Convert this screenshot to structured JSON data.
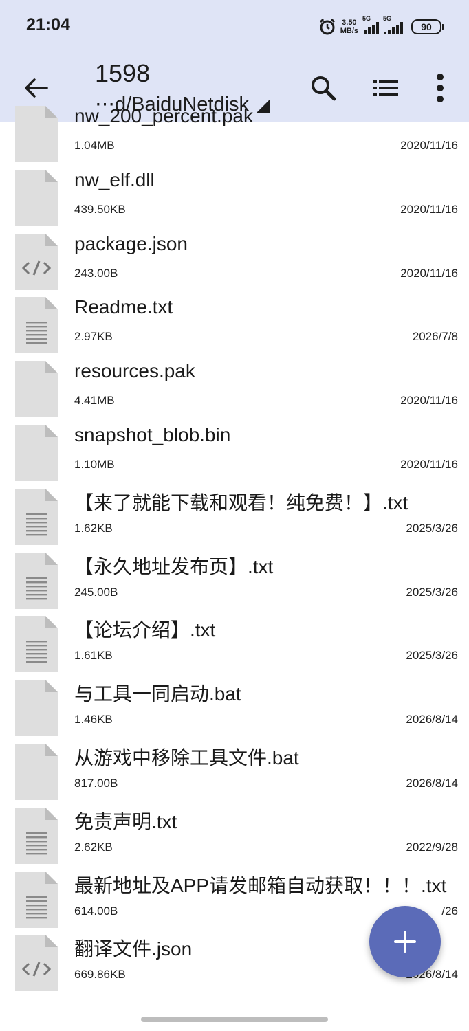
{
  "status": {
    "time": "21:04",
    "speed_value": "3.50",
    "speed_unit": "MB/s",
    "sim1_label": "5G",
    "sim2_label": "5G",
    "battery": "90",
    "icons": [
      "alarm-icon",
      "signal-icon",
      "battery-icon"
    ]
  },
  "appbar": {
    "title": "1598",
    "path": "⋯d/BaiduNetdisk",
    "icons": [
      "back-arrow-icon",
      "search-icon",
      "list-view-icon",
      "more-vert-icon"
    ]
  },
  "files": [
    {
      "name": "nw_200_percent.pak",
      "size": "1.04MB",
      "date": "2020/11/16",
      "icon": "file-generic"
    },
    {
      "name": "nw_elf.dll",
      "size": "439.50KB",
      "date": "2020/11/16",
      "icon": "file-generic"
    },
    {
      "name": "package.json",
      "size": "243.00B",
      "date": "2020/11/16",
      "icon": "file-code"
    },
    {
      "name": "Readme.txt",
      "size": "2.97KB",
      "date": "2026/7/8",
      "icon": "file-text"
    },
    {
      "name": "resources.pak",
      "size": "4.41MB",
      "date": "2020/11/16",
      "icon": "file-generic"
    },
    {
      "name": "snapshot_blob.bin",
      "size": "1.10MB",
      "date": "2020/11/16",
      "icon": "file-generic"
    },
    {
      "name": "【来了就能下载和观看！纯免费！】.txt",
      "size": "1.62KB",
      "date": "2025/3/26",
      "icon": "file-text"
    },
    {
      "name": "【永久地址发布页】.txt",
      "size": "245.00B",
      "date": "2025/3/26",
      "icon": "file-text"
    },
    {
      "name": "【论坛介绍】.txt",
      "size": "1.61KB",
      "date": "2025/3/26",
      "icon": "file-text"
    },
    {
      "name": "与工具一同启动.bat",
      "size": "1.46KB",
      "date": "2026/8/14",
      "icon": "file-generic"
    },
    {
      "name": "从游戏中移除工具文件.bat",
      "size": "817.00B",
      "date": "2026/8/14",
      "icon": "file-generic"
    },
    {
      "name": "免责声明.txt",
      "size": "2.62KB",
      "date": "2022/9/28",
      "icon": "file-text"
    },
    {
      "name": "最新地址及APP请发邮箱自动获取！！！.txt",
      "size": "614.00B",
      "date": "/26",
      "icon": "file-text"
    },
    {
      "name": "翻译文件.json",
      "size": "669.86KB",
      "date": "2026/8/14",
      "icon": "file-code"
    }
  ],
  "fab": {
    "icon": "plus-icon"
  },
  "colors": {
    "bar_bg": "#dfe4f6",
    "fab": "#5b6bb8",
    "file_icon": "#dedede"
  }
}
